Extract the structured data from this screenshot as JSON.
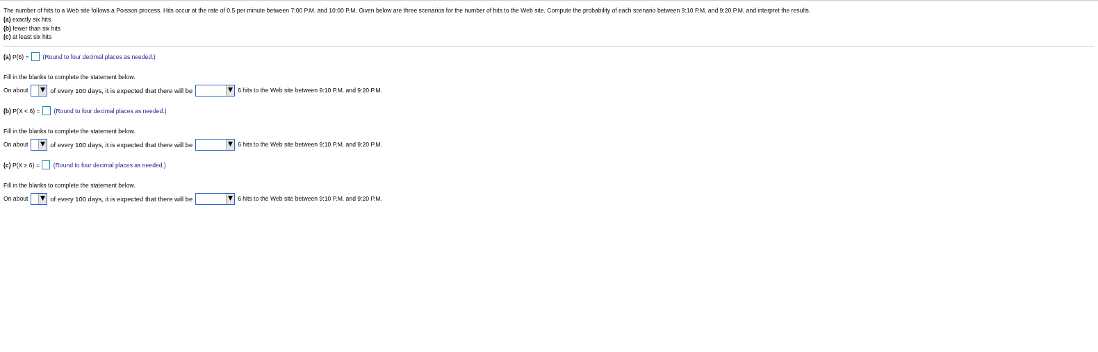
{
  "question": {
    "text": "The number of hits to a Web site follows a Poisson process. Hits occur at the rate of 0.5 per minute between 7:00 P.M. and 10:00 P.M. Given below are three scenarios for the number of hits to the Web site. Compute the probability of each scenario between 9:10 P.M. and 9:20 P.M. and interpret the results.",
    "options": [
      "**(a)** exactly six hits",
      "**(b)** fewer than six hits",
      "**(c)** at least six hits"
    ]
  },
  "parts": [
    {
      "expression": "**(a)** P(6) =",
      "hint": "(Round to four decimal places as needed.)",
      "instruction": "Fill in the blanks to complete the statement below.",
      "before": "On about",
      "middle": "of every 100 days, it is expected that there will be",
      "after": "6 hits to the Web site between 9:10 P.M. and 9:20 P.M."
    },
    {
      "expression": "**(b)** P(X < 6) =",
      "hint": "(Round to four decimal places as needed.)",
      "instruction": "Fill in the blanks to complete the statement below.",
      "before": "On about",
      "middle": "of every 100 days, it is expected that there will be",
      "after": "6 hits to the Web site between 9:10 P.M. and 9:20 P.M."
    },
    {
      "expression": "**(c)** P(X ≥ 6) =",
      "hint": "(Round to four decimal places as needed.)",
      "instruction": "Fill in the blanks to complete the statement below.",
      "before": "On about",
      "middle": "of every 100 days, it is expected that there will be",
      "after": "6 hits to the Web site between 9:10 P.M. and 9:20 P.M."
    }
  ]
}
